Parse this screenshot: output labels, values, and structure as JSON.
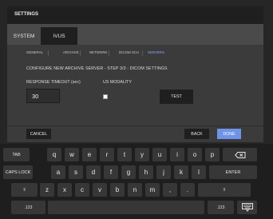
{
  "window": {
    "title": "SETTINGS"
  },
  "tabs": [
    {
      "label": "SYSTEM"
    },
    {
      "label": "IVUS"
    }
  ],
  "subnav": [
    "GENERAL",
    "ARCHIVE",
    "NETWORK",
    "DICOM SCU",
    "SERVERS"
  ],
  "content": {
    "step_title": "CONFIGURE NEW ARCHIVE SERVER - STEP 3/3 - DICOM SETTINGS",
    "response_timeout_label": "RESPONSE TIMEOUT (sec)",
    "response_timeout_value": "30",
    "us_modality_label": "US MODALITY",
    "us_modality_checked": false,
    "test_label": "TEST"
  },
  "footer": {
    "cancel": "CANCEL",
    "back": "BACK",
    "done": "DONE"
  },
  "keyboard": {
    "row1": {
      "tab": "TAB",
      "keys": [
        "q",
        "w",
        "e",
        "r",
        "t",
        "y",
        "u",
        "i",
        "o",
        "p"
      ],
      "backspace": "backspace-icon"
    },
    "row2": {
      "caps": "CAPS LOCK",
      "keys": [
        "a",
        "s",
        "d",
        "f",
        "g",
        "h",
        "j",
        "k",
        "l"
      ],
      "enter": "ENTER"
    },
    "row3": {
      "shift_left": "⇧",
      "keys": [
        "z",
        "x",
        "c",
        "v",
        "b",
        "n",
        "m",
        ",",
        "."
      ],
      "shift_right": "⇧"
    },
    "row4": {
      "num_left": ".123",
      "space": "",
      "num_right": ".123",
      "hide": "keyboard-hide-icon"
    }
  },
  "colors": {
    "accent": "#8aa7ff",
    "done_button": "#6f93e6",
    "background": "#262626"
  }
}
